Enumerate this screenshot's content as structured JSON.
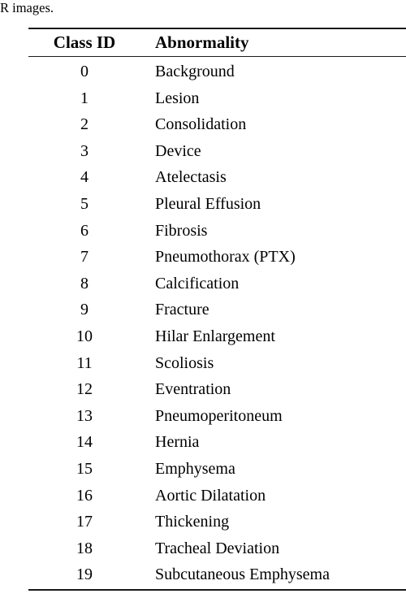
{
  "page": {
    "fragment_text": "R images."
  },
  "table": {
    "columns": [
      {
        "key": "class_id",
        "header": "Class ID",
        "align": "center"
      },
      {
        "key": "abnormality",
        "header": "Abnormality",
        "align": "left"
      }
    ],
    "rows": [
      {
        "class_id": "0",
        "abnormality": "Background"
      },
      {
        "class_id": "1",
        "abnormality": "Lesion"
      },
      {
        "class_id": "2",
        "abnormality": "Consolidation"
      },
      {
        "class_id": "3",
        "abnormality": "Device"
      },
      {
        "class_id": "4",
        "abnormality": "Atelectasis"
      },
      {
        "class_id": "5",
        "abnormality": "Pleural Effusion"
      },
      {
        "class_id": "6",
        "abnormality": "Fibrosis"
      },
      {
        "class_id": "7",
        "abnormality": "Pneumothorax (PTX)"
      },
      {
        "class_id": "8",
        "abnormality": "Calcification"
      },
      {
        "class_id": "9",
        "abnormality": "Fracture"
      },
      {
        "class_id": "10",
        "abnormality": "Hilar Enlargement"
      },
      {
        "class_id": "11",
        "abnormality": "Scoliosis"
      },
      {
        "class_id": "12",
        "abnormality": "Eventration"
      },
      {
        "class_id": "13",
        "abnormality": "Pneumoperitoneum"
      },
      {
        "class_id": "14",
        "abnormality": "Hernia"
      },
      {
        "class_id": "15",
        "abnormality": "Emphysema"
      },
      {
        "class_id": "16",
        "abnormality": "Aortic Dilatation"
      },
      {
        "class_id": "17",
        "abnormality": "Thickening"
      },
      {
        "class_id": "18",
        "abnormality": "Tracheal Deviation"
      },
      {
        "class_id": "19",
        "abnormality": "Subcutaneous Emphysema"
      }
    ]
  },
  "colors": {
    "background": "#ffffff",
    "text": "#000000",
    "rule": "#1a1a1a"
  }
}
